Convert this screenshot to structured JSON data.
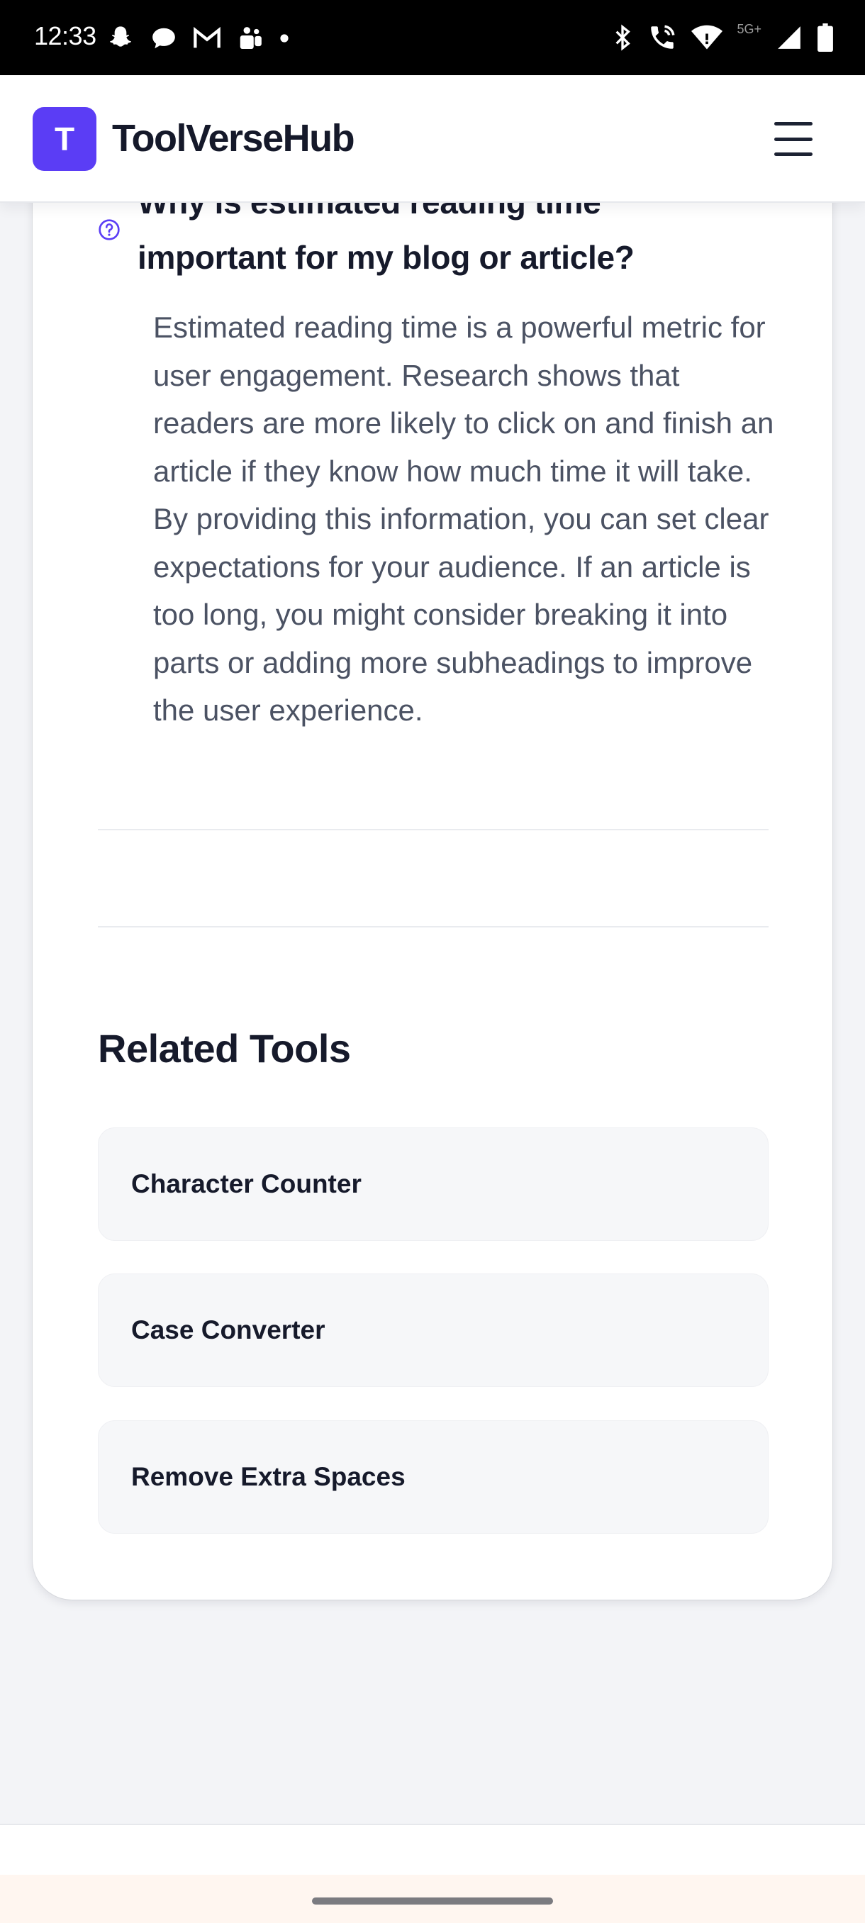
{
  "status_bar": {
    "time": "12:33",
    "network_label": "5G+",
    "left_icons": [
      "snapchat-icon",
      "chat-icon",
      "gmail-icon",
      "teams-icon",
      "dot-icon"
    ],
    "right_icons": [
      "bluetooth-icon",
      "wifi-calling-icon",
      "wifi-icon",
      "signal-icon",
      "battery-icon"
    ]
  },
  "header": {
    "logo_letter": "T",
    "site_name": "ToolVerseHub",
    "brand_color": "#5b3df5"
  },
  "faq": {
    "question": "Why is estimated reading time important for my blog or article?",
    "answer": "Estimated reading time is a powerful metric for user engagement. Research shows that readers are more likely to click on and finish an article if they know how much time it will take. By providing this information, you can set clear expectations for your audience. If an article is too long, you might consider breaking it into parts or adding more subheadings to improve the user experience."
  },
  "related": {
    "heading": "Related Tools",
    "tools": [
      {
        "label": "Character Counter"
      },
      {
        "label": "Case Converter"
      },
      {
        "label": "Remove Extra Spaces"
      }
    ]
  }
}
